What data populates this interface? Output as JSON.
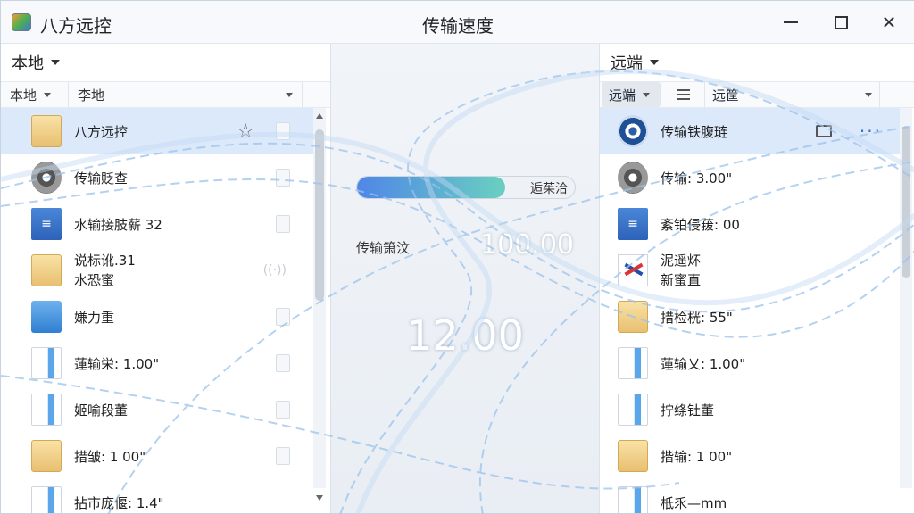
{
  "app": {
    "title": "八方远控",
    "center_title": "传输速度"
  },
  "window_controls": {
    "minimize": "—",
    "maximize": "☐",
    "close": "✕"
  },
  "left": {
    "header": "本地",
    "toolbar": {
      "location": "本地",
      "path": "李地"
    },
    "items": [
      {
        "name": "八方远控",
        "icon": "folder-tan",
        "selected": true
      },
      {
        "name": "传输貶查",
        "icon": "disc"
      },
      {
        "name": "水输接肢薪 32",
        "icon": "blue-doc"
      },
      {
        "name": "说标讹.31",
        "sub": "水恐蜜",
        "icon": "folder-tan"
      },
      {
        "name": "嫌力重",
        "icon": "folder-blue"
      },
      {
        "name": "蓮输栄: 1.00\"",
        "icon": "paper-blue"
      },
      {
        "name": "姬喻段董",
        "icon": "paper-blue"
      },
      {
        "name": "措皱: 1 00\"",
        "icon": "folder-tan"
      },
      {
        "name": "拈市庞偃: 1.4\"",
        "icon": "paper-blue"
      }
    ]
  },
  "middle": {
    "progress_label": "逅茱洽",
    "progress_value": 0.68,
    "rate_label": "传输箫汶",
    "rate_value": "100.00",
    "speed_value": "12.00"
  },
  "right": {
    "header": "远端",
    "toolbar": {
      "location": "远端",
      "path": "远筐"
    },
    "items": [
      {
        "name": "传输铁腹琏",
        "icon": "eye",
        "selected": true
      },
      {
        "name": "传输: 3.00\"",
        "icon": "disc"
      },
      {
        "name": "紊铂侵菝: 00",
        "icon": "blue-doc"
      },
      {
        "name": "泥遥炋",
        "sub": "新蜜直",
        "icon": "red-x"
      },
      {
        "name": "措检桄: 55\"",
        "icon": "folder-tan"
      },
      {
        "name": "蓮输乂: 1.00\"",
        "icon": "paper-blue"
      },
      {
        "name": "拧绦钍董",
        "icon": "paper-blue"
      },
      {
        "name": "揩输: 1 00\"",
        "icon": "folder-tan"
      },
      {
        "name": "柢乑—mm",
        "icon": "paper-blue"
      }
    ]
  }
}
